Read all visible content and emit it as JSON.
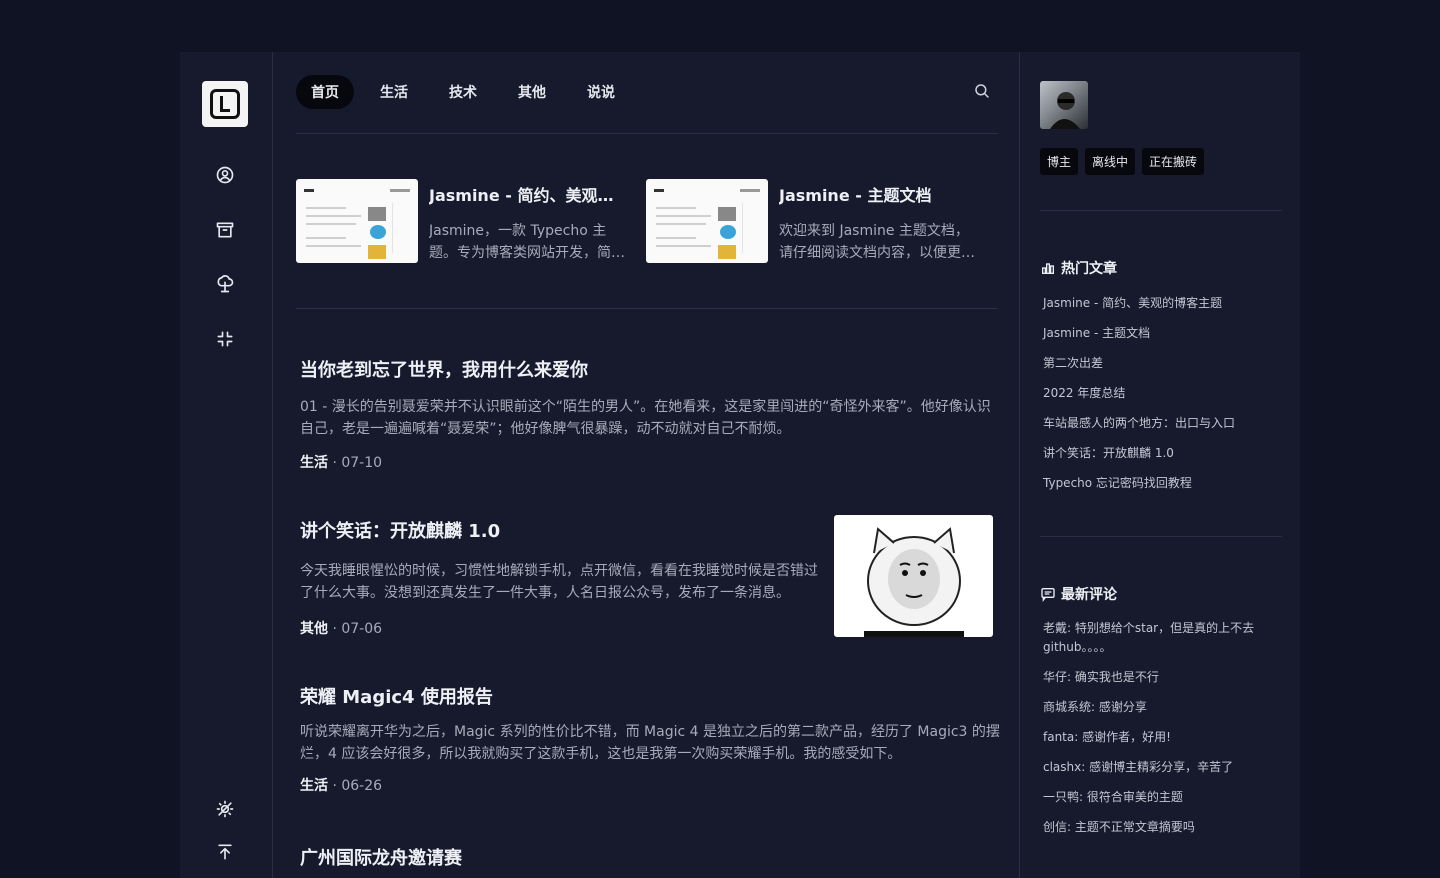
{
  "nav": {
    "items": [
      "首页",
      "生活",
      "技术",
      "其他",
      "说说"
    ],
    "active_index": 0
  },
  "featured": [
    {
      "title": "Jasmine - 简约、美观的博客主题",
      "desc": "Jasmine，一款 Typecho 主题。专为博客类网站开发，简约、美观"
    },
    {
      "title": "Jasmine - 主题文档",
      "desc": "欢迎来到 Jasmine 主题文档，请仔细阅读文档内容，以便更好地使用"
    }
  ],
  "posts": [
    {
      "title": "当你老到忘了世界，我用什么来爱你",
      "excerpt": "01 - 漫长的告别聂爱荣并不认识眼前这个“陌生的男人”。在她看来，这是家里闯进的“奇怪外来客”。他好像认识自己，老是一遍遍喊着“聂爱荣”；他好像脾气很暴躁，动不动就对自己不耐烦。",
      "category": "生活",
      "date": "07-10"
    },
    {
      "title": "讲个笑话：开放麒麟 1.0",
      "excerpt": "今天我睡眼惺忪的时候，习惯性地解锁手机，点开微信，看看在我睡觉时候是否错过了什么大事。没想到还真发生了一件大事，人名日报公众号，发布了一条消息。",
      "category": "其他",
      "date": "07-06"
    },
    {
      "title": "荣耀 Magic4 使用报告",
      "excerpt": "听说荣耀离开华为之后，Magic 系列的性价比不错，而 Magic 4 是独立之后的第二款产品，经历了 Magic3 的摆烂，4 应该会好很多，所以我就购买了这款手机，这也是我第一次购买荣耀手机。我的感受如下。",
      "category": "生活",
      "date": "06-26"
    },
    {
      "title": "广州国际龙舟邀请赛"
    }
  ],
  "profile": {
    "badges": [
      "博主",
      "离线中",
      "正在搬砖"
    ]
  },
  "hot": {
    "title": "热门文章",
    "items": [
      "Jasmine - 简约、美观的博客主题",
      "Jasmine - 主题文档",
      "第二次出差",
      "2022 年度总结",
      "车站最感人的两个地方：出口与入口",
      "讲个笑话：开放麒麟 1.0",
      "Typecho 忘记密码找回教程"
    ]
  },
  "comments": {
    "title": "最新评论",
    "items": [
      "老戴: 特别想给个star，但是真的上不去github。。。。",
      "华仔: 确实我也是不行",
      "商城系统: 感谢分享",
      "fanta: 感谢作者，好用!",
      "clashx: 感谢博主精彩分享，辛苦了",
      "一只鸭: 很符合审美的主题",
      "创信: 主题不正常文章摘要吗"
    ]
  },
  "colors": {
    "page_bg": "#0f1324",
    "panel_bg": "#161a2c",
    "active_pill": "#07080d",
    "muted_text": "#a7abb9"
  }
}
